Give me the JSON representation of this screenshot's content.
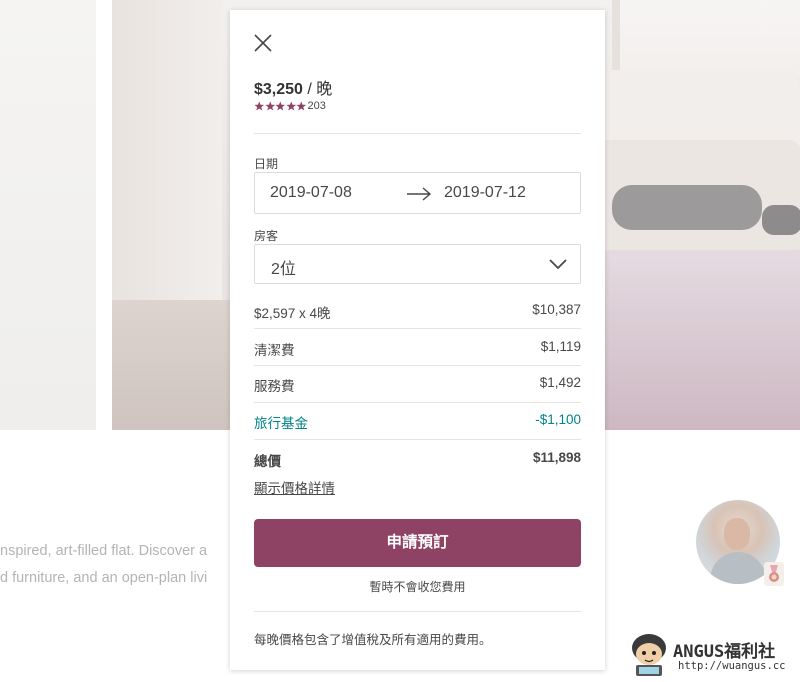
{
  "background": {
    "description_line1": "nspired, art-filled flat. Discover a",
    "description_line2": "d furniture, and an open-plan livi"
  },
  "booking": {
    "close_icon": "close-icon",
    "price_amount": "$3,250",
    "price_unit": " / 晚",
    "rating_stars": 5,
    "rating_count": "203",
    "dates_label": "日期",
    "check_in": "2019-07-08",
    "check_out": "2019-07-12",
    "arrow_icon": "arrow-right-icon",
    "guests_label": "房客",
    "guests_value": "2位",
    "chevron_icon": "chevron-down-icon",
    "lines": [
      {
        "label": "$2,597 x 4晚",
        "value": "$10,387"
      },
      {
        "label": "清潔費",
        "value": "$1,119"
      },
      {
        "label": "服務費",
        "value": "$1,492"
      },
      {
        "label": "旅行基金",
        "value": "-$1,100"
      }
    ],
    "total_label": "總價",
    "total_value": "$11,898",
    "details_link": "顯示價格詳情",
    "book_button": "申請預訂",
    "no_charge_note": "暫時不會收您費用",
    "footer_note": "每晚價格包含了增值稅及所有適用的費用。"
  },
  "watermark": {
    "title": "ANGUS福利社",
    "url": "http://wuangus.cc"
  },
  "colors": {
    "brand": "#8e4264",
    "credit": "#008489",
    "star": "#8e4264"
  }
}
